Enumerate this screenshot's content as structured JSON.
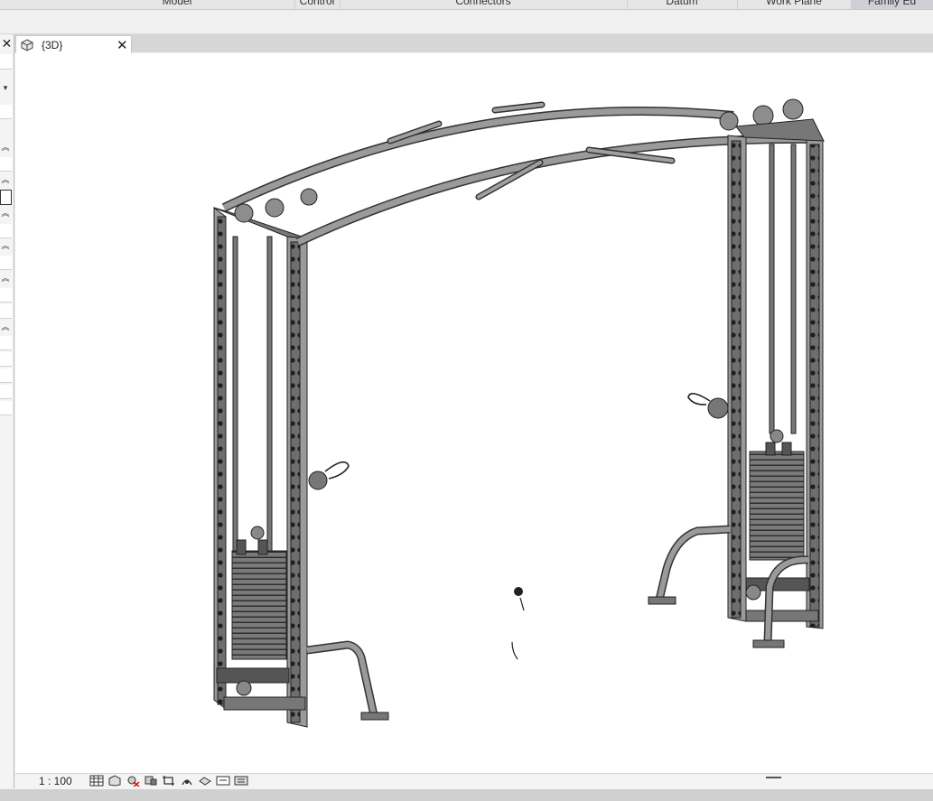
{
  "ribbon": {
    "tabs": [
      {
        "label": "Model"
      },
      {
        "label": "Control"
      },
      {
        "label": "Connectors"
      },
      {
        "label": "Datum"
      },
      {
        "label": "Work Plane"
      },
      {
        "label": "Family Ed"
      }
    ]
  },
  "view_tab": {
    "label": "{3D}",
    "icon": "3d-view-icon"
  },
  "statusbar": {
    "scale": "1 : 100",
    "tool_icons": [
      "detail-level-icon",
      "visual-style-icon",
      "sun-path-icon",
      "shadows-icon",
      "crop-view-icon",
      "show-crop-icon",
      "unlock-3d-icon",
      "temporary-hide-icon",
      "reveal-hidden-icon"
    ]
  },
  "colors": {
    "steel_dark": "#4a4a4a",
    "steel_mid": "#808080",
    "steel_light": "#b5b5b5"
  }
}
